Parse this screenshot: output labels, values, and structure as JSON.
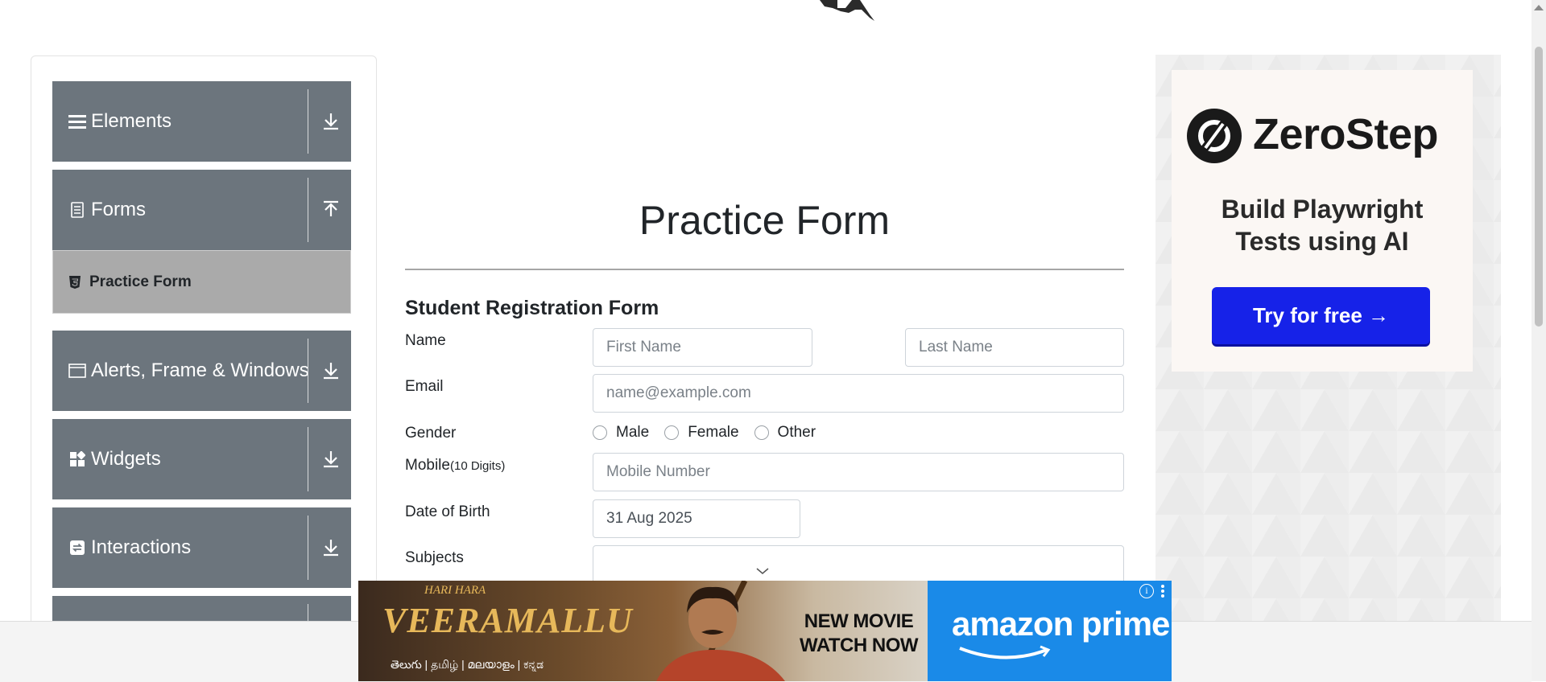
{
  "sidebar": {
    "groups": [
      {
        "label": "Elements",
        "icon": "hamburger-icon",
        "arrow": "download-arrow-icon"
      },
      {
        "label": "Forms",
        "icon": "document-icon",
        "arrow": "upload-arrow-icon"
      },
      {
        "label": "Alerts, Frame & Windows",
        "icon": "window-icon",
        "arrow": "download-arrow-icon"
      },
      {
        "label": "Widgets",
        "icon": "widgets-icon",
        "arrow": "download-arrow-icon"
      },
      {
        "label": "Interactions",
        "icon": "interactions-icon",
        "arrow": "download-arrow-icon"
      }
    ],
    "active_item": "Practice Form"
  },
  "main": {
    "title": "Practice Form",
    "form_heading": "Student Registration Form",
    "labels": {
      "name": "Name",
      "email": "Email",
      "gender": "Gender",
      "mobile": "Mobile",
      "mobile_hint": "(10 Digits)",
      "dob": "Date of Birth",
      "subjects": "Subjects"
    },
    "placeholders": {
      "first_name": "First Name",
      "last_name": "Last Name",
      "email": "name@example.com",
      "mobile": "Mobile Number"
    },
    "dob_value": "31 Aug 2025",
    "gender_options": [
      "Male",
      "Female",
      "Other"
    ]
  },
  "ad_right": {
    "brand": "ZeroStep",
    "tagline_line1": "Build Playwright",
    "tagline_line2": "Tests using AI",
    "cta": "Try for free →",
    "button_color": "#1622e8"
  },
  "ad_bottom": {
    "movie_sub": "HARI HARA",
    "movie_title": "VEERAMALLU",
    "languages": "తెలుగు | தமிழ் | മലയാളം | ಕನ್ನಡ",
    "line1": "NEW MOVIE",
    "line2": "WATCH NOW",
    "prime_text": "amazon prime",
    "prime_color": "#1a8ae8"
  },
  "colors": {
    "sidebar_group_bg": "#6c757d",
    "active_item_bg": "#aaaaaa"
  }
}
